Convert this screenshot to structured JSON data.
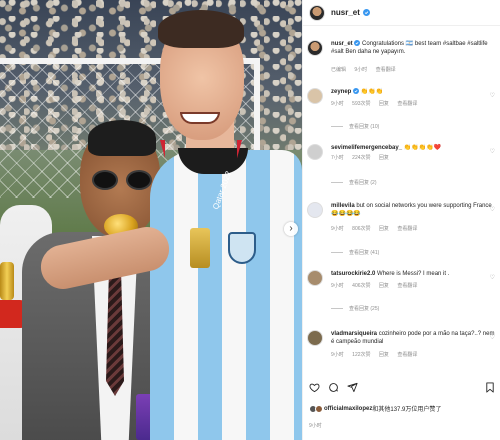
{
  "post": {
    "username": "nusr_et",
    "caption_user": "nusr_et",
    "caption": "Congratulations 🇦🇷 best team #saltbae #saltlife #salt Ben daha ne yapayım.",
    "caption_meta": {
      "translation": "已编辑",
      "time": "9小时",
      "see_translation": "查看翻译"
    },
    "photo_jersey_text": "Qatar 2022"
  },
  "comments": [
    {
      "username": "zeynep",
      "text": "👏👏👏",
      "time": "9小时",
      "likes": "593次赞",
      "reply": "回复",
      "translate": "查看翻译",
      "replies": "查看回复 (10)"
    },
    {
      "username": "sevimelifemergencebay_",
      "text": "👏👏👏👏❤️",
      "time": "7小时",
      "likes": "224次赞",
      "reply": "回复",
      "translate": "",
      "replies": "查看回复 (2)"
    },
    {
      "username": "millevila",
      "text": "but on social networks you were supporting France 😂😂😂😂",
      "time": "9小时",
      "likes": "806次赞",
      "reply": "回复",
      "translate": "查看翻译",
      "replies": "查看回复 (41)"
    },
    {
      "username": "tatsurockirie2.0",
      "text": "Where is Messi? I mean it .",
      "time": "9小时",
      "likes": "406次赞",
      "reply": "回复",
      "translate": "查看翻译",
      "replies": "查看回复 (25)"
    },
    {
      "username": "vladmarsiqueira",
      "text": "cozinheiro pode por a mão na taça?..? nem é campeão mundial",
      "time": "9小时",
      "likes": "122次赞",
      "reply": "回复",
      "translate": "查看翻译",
      "replies": ""
    }
  ],
  "likes": {
    "user": "officialmaxilopez",
    "rest": "和其他137.9万位用户赞了"
  },
  "post_time": "9小时",
  "icons": [
    "heart-icon",
    "comment-icon",
    "share-icon",
    "bookmark-icon",
    "verified-badge-icon",
    "next-arrow-icon"
  ],
  "colors": {
    "verified": "#3897f0",
    "meta_gray": "#8e8e8e",
    "jersey_blue": "#8fc7ec"
  }
}
